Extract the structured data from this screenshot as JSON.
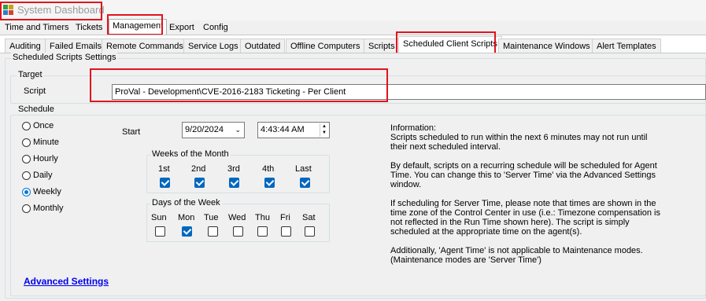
{
  "window": {
    "title": "System Dashboard",
    "icon": "app-grid-icon"
  },
  "top_tabs": [
    {
      "label": "Time and Timers",
      "active": false
    },
    {
      "label": "Tickets",
      "active": false
    },
    {
      "label": "Management",
      "active": true
    },
    {
      "label": "Export",
      "active": false
    },
    {
      "label": "Config",
      "active": false
    }
  ],
  "sub_tabs": [
    {
      "label": "Auditing",
      "active": false
    },
    {
      "label": "Failed Emails",
      "active": false
    },
    {
      "label": "Remote Commands",
      "active": false
    },
    {
      "label": "Service Logs",
      "active": false
    },
    {
      "label": "Outdated",
      "active": false
    },
    {
      "label": "Offline Computers",
      "active": false
    },
    {
      "label": "Scripts",
      "active": false
    },
    {
      "label": "Scheduled Client Scripts",
      "active": true
    },
    {
      "label": "Maintenance Windows",
      "active": false
    },
    {
      "label": "Alert Templates",
      "active": false
    }
  ],
  "section_title": "Scheduled Scripts Settings",
  "target": {
    "group_label": "Target",
    "script_label": "Script",
    "script_value": "ProVal - Development\\CVE-2016-2183 Ticketing - Per Client"
  },
  "schedule": {
    "group_label": "Schedule",
    "options": [
      {
        "label": "Once",
        "selected": false
      },
      {
        "label": "Minute",
        "selected": false
      },
      {
        "label": "Hourly",
        "selected": false
      },
      {
        "label": "Daily",
        "selected": false
      },
      {
        "label": "Weekly",
        "selected": true
      },
      {
        "label": "Monthly",
        "selected": false
      }
    ],
    "start_label": "Start",
    "start_date": "9/20/2024",
    "start_time": "4:43:44 AM",
    "weeks_label": "Weeks of the Month",
    "weeks": [
      {
        "label": "1st",
        "checked": true
      },
      {
        "label": "2nd",
        "checked": true
      },
      {
        "label": "3rd",
        "checked": true
      },
      {
        "label": "4th",
        "checked": true
      },
      {
        "label": "Last",
        "checked": true
      }
    ],
    "days_label": "Days of the Week",
    "days": [
      {
        "label": "Sun",
        "checked": false
      },
      {
        "label": "Mon",
        "checked": true
      },
      {
        "label": "Tue",
        "checked": false
      },
      {
        "label": "Wed",
        "checked": false
      },
      {
        "label": "Thu",
        "checked": false
      },
      {
        "label": "Fri",
        "checked": false
      },
      {
        "label": "Sat",
        "checked": false
      }
    ]
  },
  "information": [
    "Information:\nScripts scheduled to run within the next 6 minutes may not run until their next scheduled interval.",
    "By default, scripts on a recurring schedule will be scheduled for Agent Time. You can change this to 'Server Time' via the Advanced Settings window.",
    "If scheduling for Server Time, please note that times are shown in the time zone of the Control Center in use (i.e.: Timezone compensation is not reflected in the Run Time shown here). The script is simply scheduled at the appropriate time on the agent(s).",
    "Additionally, 'Agent Time' is not applicable to Maintenance modes. (Maintenance modes are 'Server Time')"
  ],
  "advanced_link": "Advanced Settings",
  "colors": {
    "highlight": "#e0141e",
    "link": "#0000ee",
    "check": "#0067c0"
  }
}
